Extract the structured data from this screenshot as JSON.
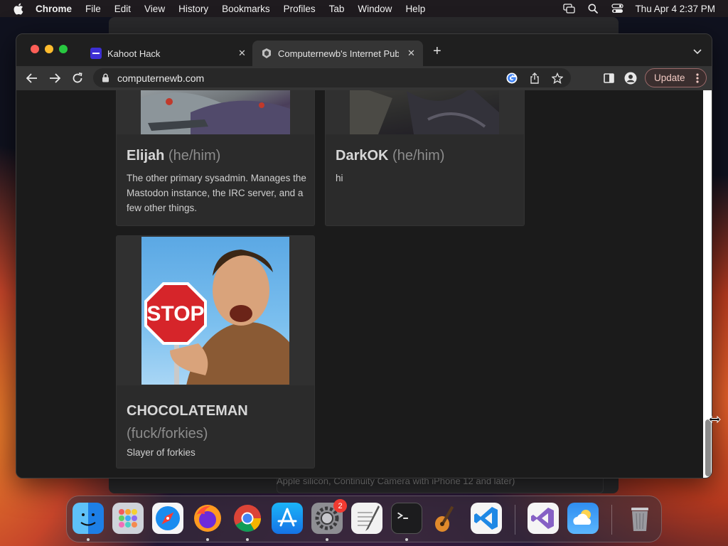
{
  "menubar": {
    "app_name": "Chrome",
    "items": [
      "File",
      "Edit",
      "View",
      "History",
      "Bookmarks",
      "Profiles",
      "Tab",
      "Window",
      "Help"
    ],
    "clock": "Thu Apr 4  2:37 PM"
  },
  "background_window": {
    "caption": "Apple silicon, Continuity Camera with iPhone 12 and later)"
  },
  "browser": {
    "tabs": [
      {
        "title": "Kahoot Hack",
        "favicon": "kahoot-favicon"
      },
      {
        "title": "Computernewb's Internet Pub",
        "favicon": "computernewb-favicon"
      }
    ],
    "url": "computernewb.com",
    "update_label": "Update"
  },
  "page": {
    "cards": [
      {
        "name": "Elijah",
        "pronouns": "(he/him)",
        "bio": "The other primary sysadmin. Manages the Mastodon instance, the IRC server, and a few other things."
      },
      {
        "name": "DarkOK",
        "pronouns": "(he/him)",
        "bio": "hi"
      },
      {
        "name": "CHOCOLATEMAN",
        "pronouns": "(fuck/forkies)",
        "bio": "Slayer of forkies",
        "image_text": "STOP"
      }
    ]
  },
  "dock": {
    "apps": [
      "finder",
      "launchpad",
      "safari",
      "firefox",
      "chrome",
      "app-store",
      "system-settings",
      "textedit",
      "terminal",
      "garageband",
      "vscode",
      "visual-studio",
      "weather",
      "trash"
    ],
    "settings_badge": "2"
  },
  "colors": {
    "update_border": "#9c6a6a",
    "close_red": "#fe5f57",
    "minimize_yellow": "#febc2e",
    "zoom_green": "#28c840"
  }
}
